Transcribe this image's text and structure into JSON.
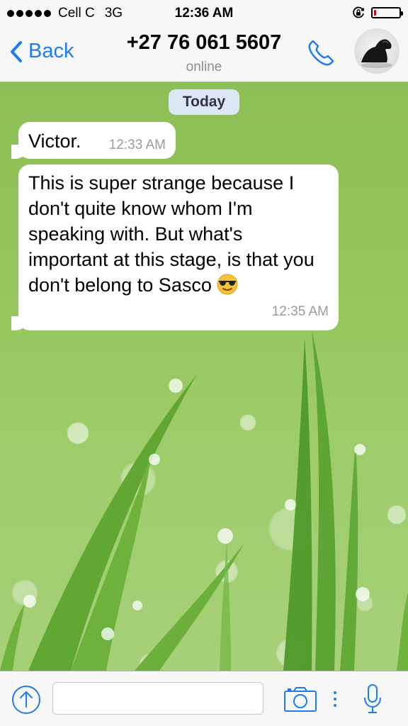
{
  "status_bar": {
    "carrier": "Cell C",
    "network": "3G",
    "time": "12:36 AM",
    "signal_bars": 5,
    "battery_level": 0.1,
    "battery_color": "#d0021b"
  },
  "nav": {
    "back_label": "Back",
    "contact_name": "+27 76 061 5607",
    "presence": "online",
    "accent_color": "#1e7cf2"
  },
  "chat": {
    "date_label": "Today",
    "messages": [
      {
        "text": "Victor.",
        "time": "12:33 AM",
        "direction": "incoming"
      },
      {
        "text": "This is super strange because I don't quite know whom I'm speaking with. But what's important at this stage, is that you don't belong to Sasco",
        "time": "12:35 AM",
        "direction": "incoming",
        "emoji": "smiling-face-with-sunglasses"
      }
    ]
  },
  "input_bar": {
    "placeholder": "",
    "icons": [
      "upload-arrow-icon",
      "camera-icon",
      "more-dots-icon",
      "microphone-icon"
    ]
  }
}
